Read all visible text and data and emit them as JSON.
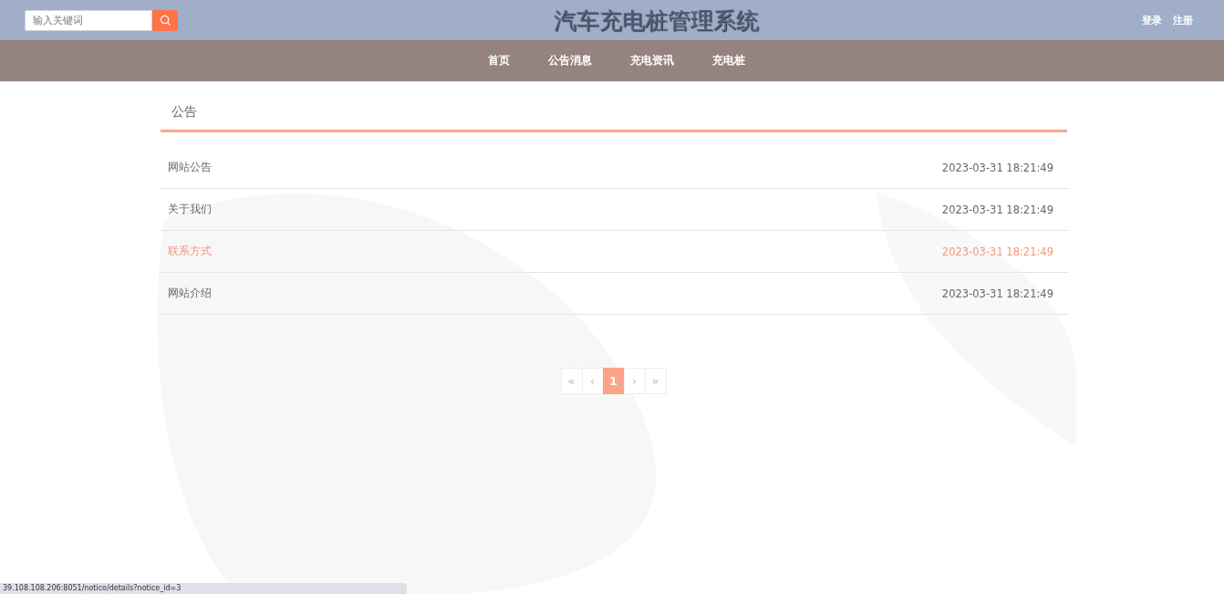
{
  "header": {
    "search": {
      "placeholder": "输入关键词"
    },
    "title": "汽车充电桩管理系统",
    "links": [
      "登录",
      "注册"
    ]
  },
  "nav": {
    "items": [
      {
        "label": "首页"
      },
      {
        "label": "公告消息"
      },
      {
        "label": "充电资讯"
      },
      {
        "label": "充电桩"
      }
    ]
  },
  "section": {
    "title": "公告"
  },
  "notices": [
    {
      "title": "网站公告",
      "time": "2023-03-31 18:21:49",
      "hovered": false
    },
    {
      "title": "关于我们",
      "time": "2023-03-31 18:21:49",
      "hovered": false
    },
    {
      "title": "联系方式",
      "time": "2023-03-31 18:21:49",
      "hovered": true
    },
    {
      "title": "网站介绍",
      "time": "2023-03-31 18:21:49",
      "hovered": false
    }
  ],
  "pagination": [
    {
      "label": "«",
      "selected": false
    },
    {
      "label": "‹",
      "selected": false
    },
    {
      "label": "1",
      "selected": true
    },
    {
      "label": "›",
      "selected": false
    },
    {
      "label": "»",
      "selected": false
    }
  ],
  "status_bar": {
    "url": "39.108.108.206:8051/notice/details?notice_id=3"
  }
}
